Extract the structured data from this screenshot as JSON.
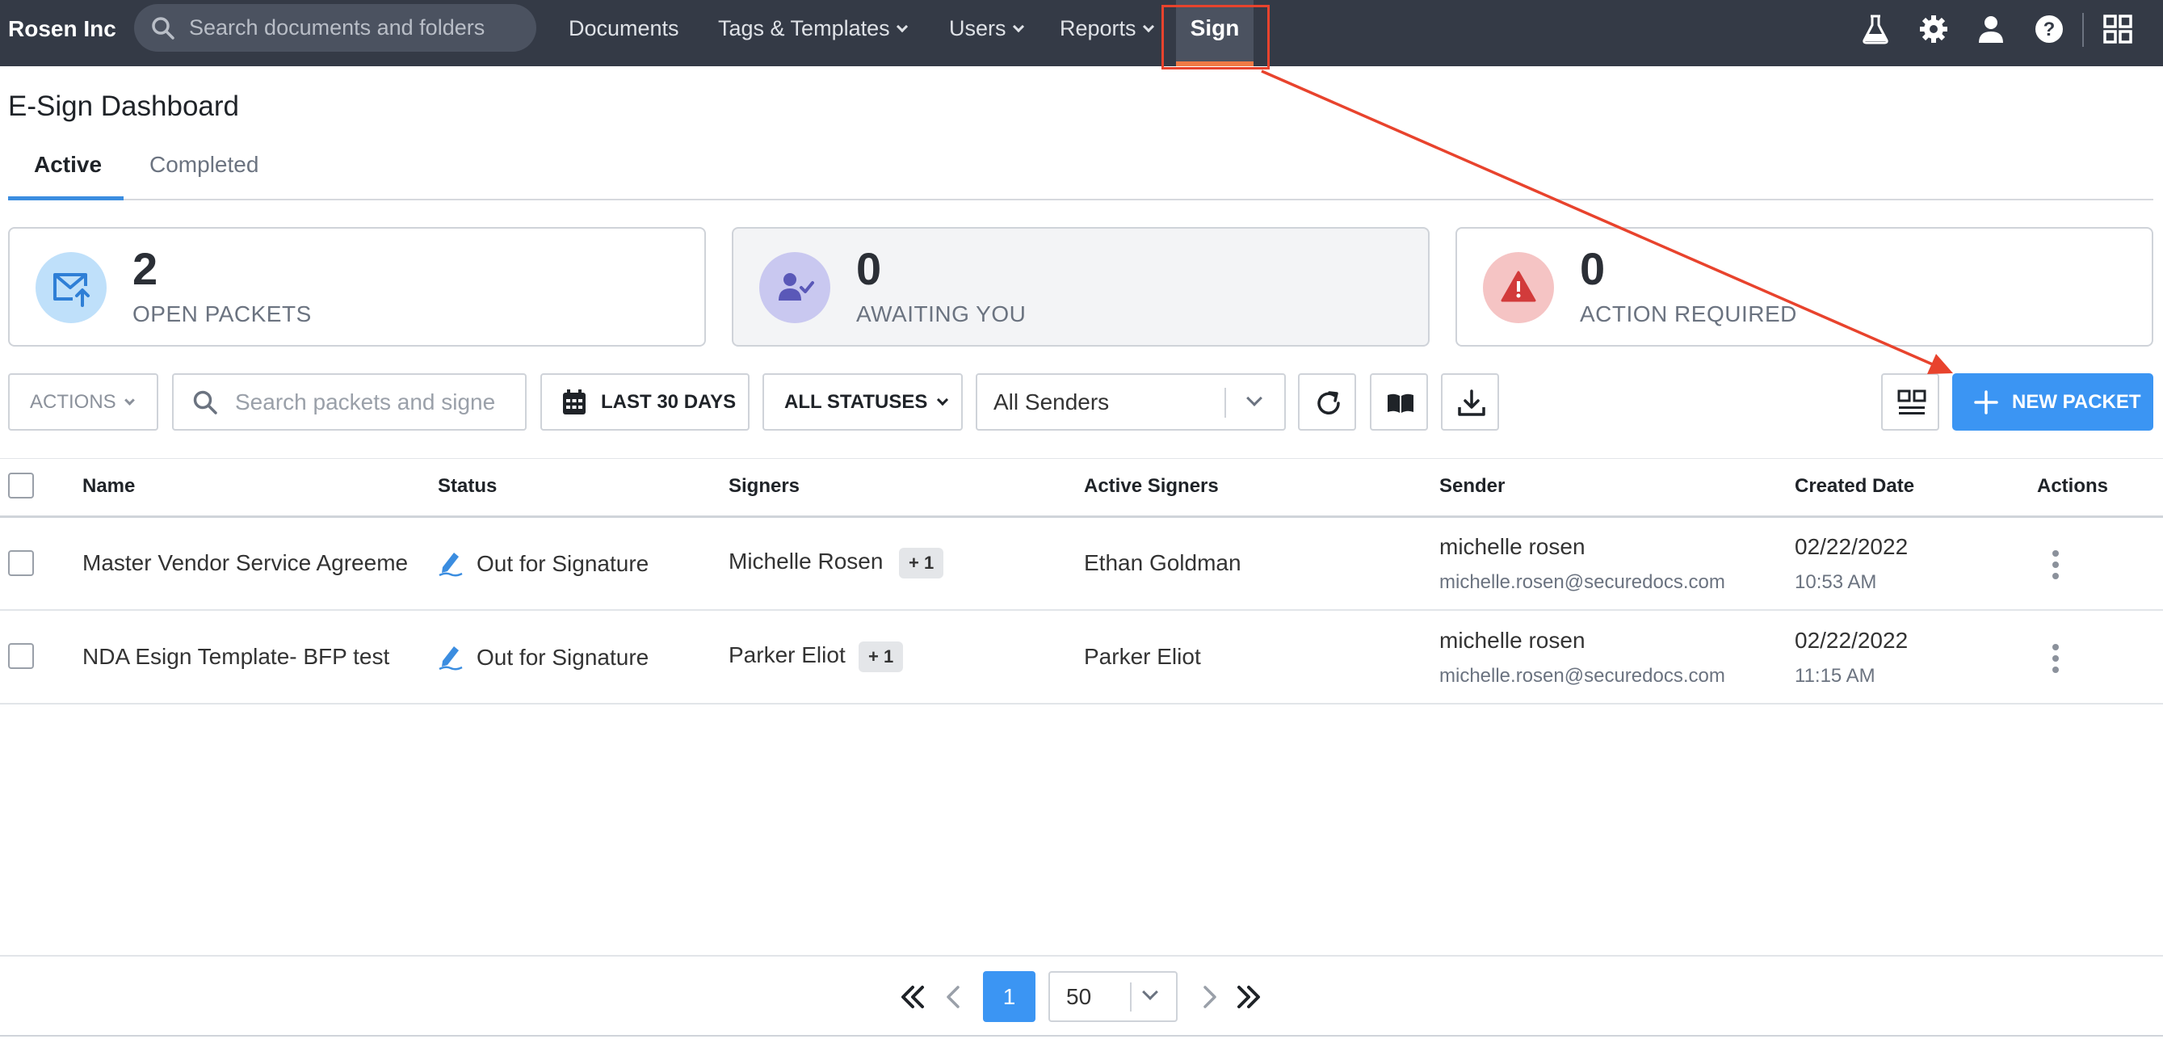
{
  "nav": {
    "brand": "Rosen Inc",
    "search_placeholder": "Search documents and folders",
    "links": {
      "documents": "Documents",
      "tags_templates": "Tags & Templates",
      "users": "Users",
      "reports": "Reports",
      "sign": "Sign"
    },
    "icons": [
      "flask-icon",
      "gear-icon",
      "user-icon",
      "help-icon",
      "apps-grid-icon"
    ]
  },
  "page": {
    "title": "E-Sign Dashboard",
    "tabs": {
      "active": "Active",
      "completed": "Completed"
    }
  },
  "cards": {
    "open": {
      "count": "2",
      "label": "OPEN PACKETS"
    },
    "awaiting": {
      "count": "0",
      "label": "AWAITING YOU"
    },
    "action": {
      "count": "0",
      "label": "ACTION REQUIRED"
    }
  },
  "toolbar": {
    "actions_label": "ACTIONS",
    "search_placeholder": "Search packets and signe",
    "date_filter": "LAST 30 DAYS",
    "status_filter": "ALL STATUSES",
    "sender_filter": "All Senders",
    "new_packet_label": "NEW PACKET"
  },
  "table": {
    "headers": {
      "name": "Name",
      "status": "Status",
      "signers": "Signers",
      "active_signers": "Active Signers",
      "sender": "Sender",
      "created": "Created Date",
      "actions": "Actions"
    },
    "rows": [
      {
        "name": "Master Vendor Service Agreeme",
        "status": "Out for Signature",
        "signer": "Michelle Rosen",
        "extra_signers": "+ 1",
        "active_signer": "Ethan Goldman",
        "sender_name": "michelle rosen",
        "sender_email": "michelle.rosen@securedocs.com",
        "date": "02/22/2022",
        "time": "10:53 AM"
      },
      {
        "name": "NDA Esign Template- BFP test",
        "status": "Out for Signature",
        "signer": "Parker Eliot",
        "extra_signers": "+ 1",
        "active_signer": "Parker Eliot",
        "sender_name": "michelle rosen",
        "sender_email": "michelle.rosen@securedocs.com",
        "date": "02/22/2022",
        "time": "11:15 AM"
      }
    ]
  },
  "pagination": {
    "current_page": "1",
    "page_size": "50"
  },
  "colors": {
    "nav_bg": "#343a46",
    "accent_blue": "#3b95f3",
    "nav_active_underline": "#f07a45",
    "annotation_red": "#e8432d"
  }
}
